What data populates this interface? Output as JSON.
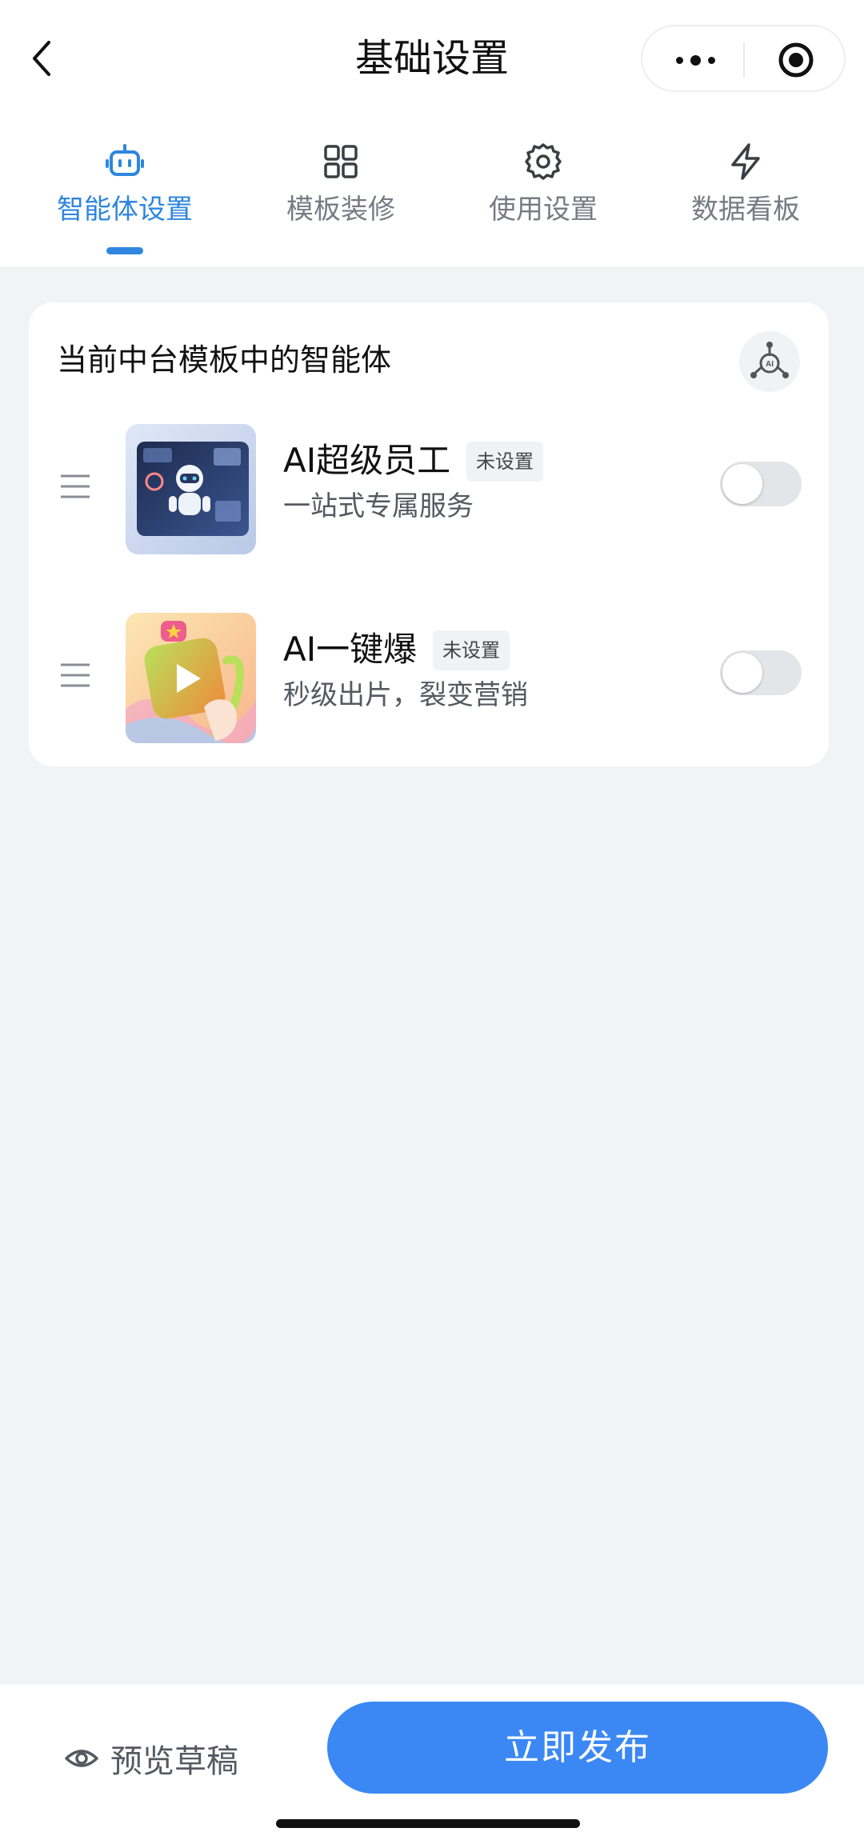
{
  "header": {
    "title": "基础设置"
  },
  "tabs": [
    {
      "label": "智能体设置",
      "icon": "robot-icon",
      "active": true
    },
    {
      "label": "模板装修",
      "icon": "grid-icon",
      "active": false
    },
    {
      "label": "使用设置",
      "icon": "gear-icon",
      "active": false
    },
    {
      "label": "数据看板",
      "icon": "lightning-icon",
      "active": false
    }
  ],
  "card": {
    "title": "当前中台模板中的智能体",
    "agents": [
      {
        "name": "AI超级员工",
        "status": "未设置",
        "description": "一站式专属服务",
        "enabled": false,
        "thumbnail": "robot-dashboard-image"
      },
      {
        "name": "AI一键爆",
        "status": "未设置",
        "description": "秒级出片，裂变营销",
        "enabled": false,
        "thumbnail": "play-cube-image"
      }
    ]
  },
  "footer": {
    "preview_label": "预览草稿",
    "publish_label": "立即发布"
  },
  "colors": {
    "accent": "#2e86de",
    "publish_button": "#3b88f5",
    "background": "#f2f3f5",
    "toggle_off": "#e4e5e8"
  }
}
